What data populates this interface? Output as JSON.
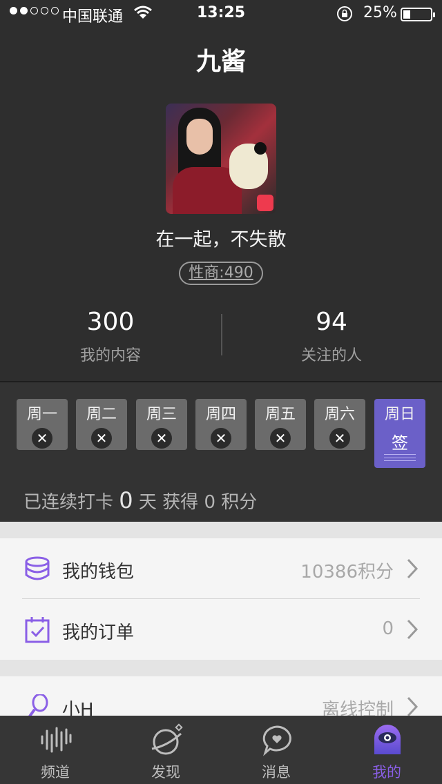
{
  "status_bar": {
    "carrier": "中国联通",
    "time": "13:25",
    "battery": "25%",
    "battery_level": 0.25,
    "signal_bars_filled": 2,
    "signal_bars_total": 5
  },
  "header": {
    "title": "九酱"
  },
  "profile": {
    "slogan": "在一起，不失散",
    "score": "性商:490"
  },
  "stats": [
    {
      "value": "300",
      "label": "我的内容"
    },
    {
      "value": "94",
      "label": "关注的人"
    }
  ],
  "checkin": {
    "days": [
      "周一",
      "周二",
      "周三",
      "周四",
      "周五",
      "周六",
      "周日"
    ],
    "today_action": "签",
    "streak_prefix": "已连续打卡",
    "streak_days": "0",
    "streak_mid": "天 获得",
    "points": "0",
    "points_unit": "积分"
  },
  "menu": {
    "wallet": {
      "label": "我的钱包",
      "value": "10386积分"
    },
    "orders": {
      "label": "我的订单",
      "value": "0"
    },
    "xiaoh": {
      "label": "小H",
      "value": "离线控制"
    }
  },
  "tabs": [
    {
      "label": "频道",
      "icon": "soundwave-icon"
    },
    {
      "label": "发现",
      "icon": "planet-icon"
    },
    {
      "label": "消息",
      "icon": "chat-heart-icon"
    },
    {
      "label": "我的",
      "icon": "eye-bot-icon"
    }
  ],
  "colors": {
    "accent": "#8a5fe6",
    "today": "#6b60c8",
    "badge": "#ee3a4e"
  }
}
